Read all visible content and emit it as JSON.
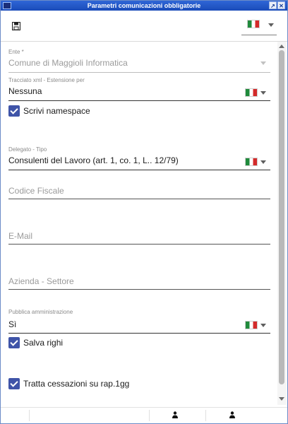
{
  "window": {
    "title": "Parametri comunicazioni obbligatorie"
  },
  "toolbar": {
    "language_flag": "italian-flag-icon"
  },
  "form": {
    "ente": {
      "label": "Ente *",
      "value": "Comune di Maggioli Informatica"
    },
    "tracciato": {
      "label": "Tracciato xml - Estensione per",
      "value": "Nessuna"
    },
    "scrivi_namespace": {
      "label": "Scrivi namespace",
      "checked": true
    },
    "delegato": {
      "label": "Delegato - Tipo",
      "value": "Consulenti del Lavoro (art. 1, co. 1, L..  12/79)"
    },
    "codice_fiscale": {
      "placeholder": "Codice Fiscale"
    },
    "email": {
      "placeholder": "E-Mail"
    },
    "azienda_settore": {
      "placeholder": "Azienda - Settore"
    },
    "pubblica_amministrazione": {
      "label": "Pubblica amministrazione",
      "value": "Sì"
    },
    "salva_righi": {
      "label": "Salva righi",
      "checked": true
    },
    "tratta_cessazioni": {
      "label": "Tratta cessazioni su rap.1gg",
      "checked": true
    }
  },
  "colors": {
    "accent": "#3f54a8",
    "titlebar": "#1f52c4"
  }
}
